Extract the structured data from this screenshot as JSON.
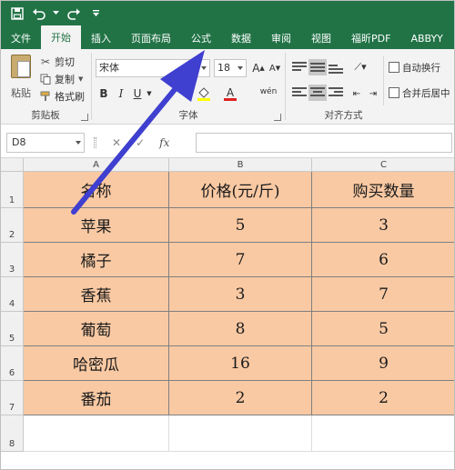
{
  "title_bar": {
    "quick_access": [
      "save-icon",
      "undo-icon",
      "redo-icon",
      "customize-icon"
    ]
  },
  "tabs": [
    {
      "label": "文件",
      "active": false
    },
    {
      "label": "开始",
      "active": true
    },
    {
      "label": "插入",
      "active": false
    },
    {
      "label": "页面布局",
      "active": false
    },
    {
      "label": "公式",
      "active": false
    },
    {
      "label": "数据",
      "active": false
    },
    {
      "label": "审阅",
      "active": false
    },
    {
      "label": "视图",
      "active": false
    },
    {
      "label": "福昕PDF",
      "active": false
    },
    {
      "label": "ABBYY",
      "active": false
    }
  ],
  "ribbon": {
    "clipboard": {
      "paste": "粘贴",
      "cut": "剪切",
      "copy": "复制",
      "format_painter": "格式刷",
      "group_label": "剪贴板"
    },
    "font": {
      "font_name": "宋体",
      "font_size": "18",
      "grow": "A",
      "shrink": "A",
      "bold": "B",
      "italic": "I",
      "underline": "U",
      "font_color_glyph": "A",
      "phonetic_glyph": "wén",
      "group_label": "字体"
    },
    "alignment": {
      "wrap_text": "自动换行",
      "merge_center": "合并后居中",
      "group_label": "对齐方式"
    }
  },
  "formula_bar": {
    "name_box": "D8",
    "fx": "fx",
    "content": ""
  },
  "sheet": {
    "columns": [
      "A",
      "B",
      "C"
    ],
    "rows": [
      "1",
      "2",
      "3",
      "4",
      "5",
      "6",
      "7",
      "8"
    ],
    "header": [
      "名称",
      "价格(元/斤)",
      "购买数量"
    ],
    "data": [
      [
        "苹果",
        "5",
        "3"
      ],
      [
        "橘子",
        "7",
        "6"
      ],
      [
        "香蕉",
        "3",
        "7"
      ],
      [
        "葡萄",
        "8",
        "5"
      ],
      [
        "哈密瓜",
        "16",
        "9"
      ],
      [
        "番茄",
        "2",
        "2"
      ]
    ]
  },
  "colors": {
    "excel_green": "#217346",
    "cell_fill": "#f9c9a3",
    "annotation_arrow": "#3f3fd0"
  }
}
